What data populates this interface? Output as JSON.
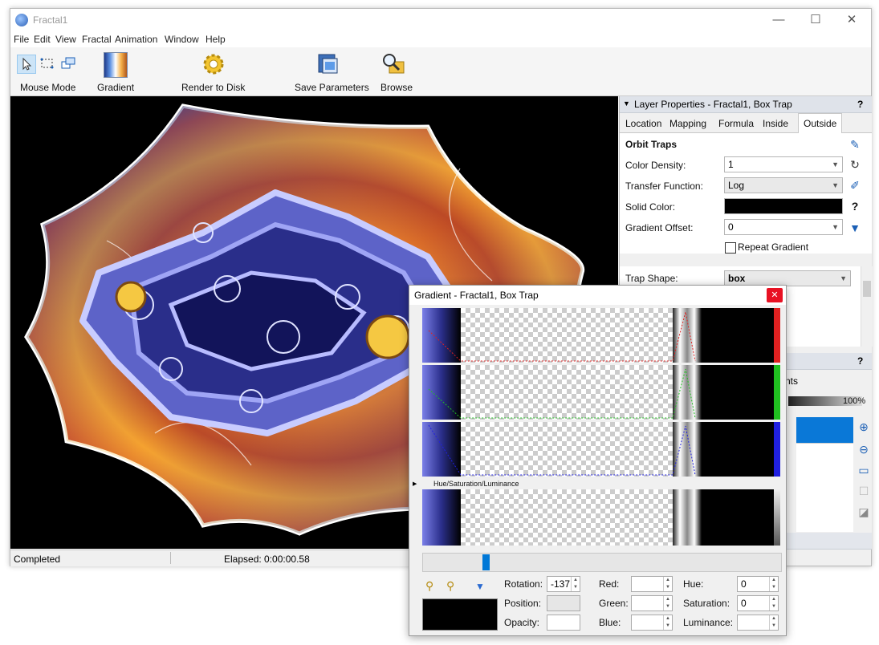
{
  "window": {
    "title": "Fractal1",
    "controls": {
      "minimize": "—",
      "maximize": "☐",
      "close": "✕"
    }
  },
  "menu": [
    "File",
    "Edit",
    "View",
    "Fractal",
    "Animation",
    "Window",
    "Help"
  ],
  "toolbar": {
    "mouse_mode": "Mouse Mode",
    "gradient": "Gradient",
    "render": "Render to Disk",
    "save_params": "Save Parameters",
    "browse": "Browse"
  },
  "status": {
    "state": "Completed",
    "elapsed": "Elapsed: 0:00:00.58"
  },
  "layer_props": {
    "header": "Layer Properties - Fractal1, Box Trap",
    "help": "?",
    "tabs": [
      "Location",
      "Mapping",
      "Formula",
      "Inside",
      "Outside"
    ],
    "active_tab": "Outside",
    "section": "Orbit Traps",
    "color_density_label": "Color Density:",
    "color_density": "1",
    "transfer_label": "Transfer Function:",
    "transfer": "Log",
    "solid_color_label": "Solid Color:",
    "solid_color": "#000000",
    "offset_label": "Gradient Offset:",
    "offset": "0",
    "repeat_label": "Repeat Gradient",
    "trap_shape_label": "Trap Shape:",
    "trap_shape": "box"
  },
  "second_panel": {
    "help": "?",
    "tab_fragment": "nts",
    "opacity": "100%"
  },
  "gradient_window": {
    "title": "Gradient - Fractal1, Box Trap",
    "close": "✕",
    "hsl_label": "Hue/Saturation/Luminance",
    "slider_position": 0.17,
    "controls": {
      "rotation_label": "Rotation:",
      "rotation": "-137",
      "position_label": "Position:",
      "position": "",
      "opacity_label": "Opacity:",
      "opacity": "",
      "red_label": "Red:",
      "red": "",
      "green_label": "Green:",
      "green": "",
      "blue_label": "Blue:",
      "blue": "",
      "hue_label": "Hue:",
      "hue": "0",
      "saturation_label": "Saturation:",
      "saturation": "0",
      "luminance_label": "Luminance:",
      "luminance": ""
    }
  },
  "colors": {
    "accent": "#0078d7",
    "channel_red": "#e02020",
    "channel_green": "#20c020",
    "channel_blue": "#2020e0",
    "fractal_blue": "#8c8cf0",
    "fractal_orange": "#e85a10"
  }
}
